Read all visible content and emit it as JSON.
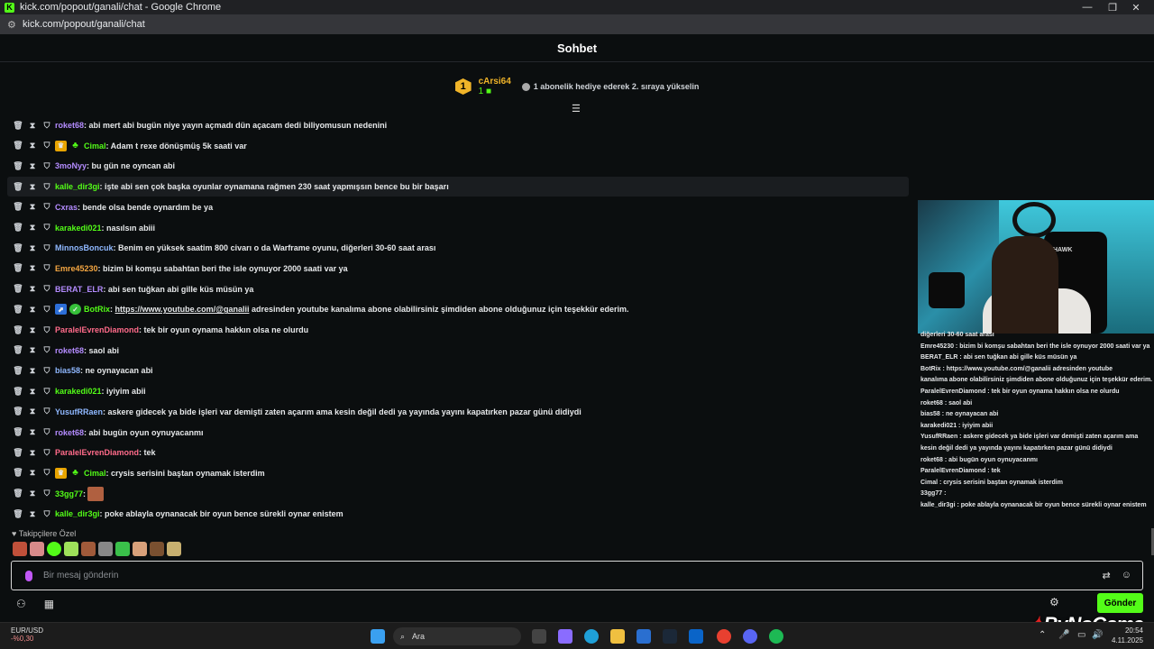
{
  "window": {
    "title": "kick.com/popout/ganali/chat - Google Chrome",
    "url": "kick.com/popout/ganali/chat",
    "favicon": "K"
  },
  "chat": {
    "header": "Sohbet",
    "pinned": {
      "rank": "1",
      "user": "cArsi64",
      "count": "1",
      "message": "1 abonelik hediye ederek 2. sıraya yükselin"
    },
    "messages": [
      {
        "user": "roket68",
        "user_color": "#b48cff",
        "badges": [],
        "text": ": abi mert abi bugün niye yayın açmadı dün açacam dedi biliyomusun nedenini"
      },
      {
        "user": "Cimal",
        "user_color": "#53fc18",
        "badges": [
          "crown",
          "clover"
        ],
        "text": ": Adam t rexe dönüşmüş 5k saati var"
      },
      {
        "user": "3moNyy",
        "user_color": "#b48cff",
        "badges": [],
        "text": ": bu gün ne oyncan abi"
      },
      {
        "user": "kalle_dir3gi",
        "user_color": "#53fc18",
        "badges": [],
        "text": ": işte abi sen çok başka oyunlar oynamana rağmen 230 saat yapmışsın bence bu bir başarı",
        "highlight": true
      },
      {
        "user": "Cxras",
        "user_color": "#b48cff",
        "badges": [],
        "text": ": bende olsa bende oynardım be ya"
      },
      {
        "user": "karakedi021",
        "user_color": "#53fc18",
        "badges": [],
        "text": ": nasılsın abiii"
      },
      {
        "user": "MinnosBoncuk",
        "user_color": "#8fb8ff",
        "badges": [],
        "text": ": Benim en yüksek saatim 800 civarı o da Warframe oyunu, diğerleri 30-60 saat arası"
      },
      {
        "user": "Emre45230",
        "user_color": "#f5a742",
        "badges": [],
        "text": ": bizim bi komşu sabahtan beri the isle oynuyor 2000 saati var ya"
      },
      {
        "user": "BERAT_ELR",
        "user_color": "#b48cff",
        "badges": [],
        "text": ": abi sen tuğkan abi gille küs müsün ya"
      },
      {
        "user": "BotRix",
        "user_color": "#53fc18",
        "badges": [
          "verified",
          "green"
        ],
        "text": ": ",
        "link": "https://www.youtube.com/@ganalii",
        "text2": " adresinden youtube kanalıma abone olabilirsiniz şimdiden abone olduğunuz için teşekkür ederim."
      },
      {
        "user": "ParalelEvrenDiamond",
        "user_color": "#ff6b8a",
        "badges": [],
        "text": ": tek bir oyun oynama hakkın olsa ne olurdu"
      },
      {
        "user": "roket68",
        "user_color": "#b48cff",
        "badges": [],
        "text": ": saol abi"
      },
      {
        "user": "bias58",
        "user_color": "#8fb8ff",
        "badges": [],
        "text": ": ne oynayacan abi"
      },
      {
        "user": "karakedi021",
        "user_color": "#53fc18",
        "badges": [],
        "text": ": iyiyim abii"
      },
      {
        "user": "YusufRRaen",
        "user_color": "#8fb8ff",
        "badges": [],
        "text": ": askere gidecek ya bide işleri var demişti zaten açarım ama kesin değil dedi ya yayında yayını kapatırken pazar günü didiydi"
      },
      {
        "user": "roket68",
        "user_color": "#b48cff",
        "badges": [],
        "text": ": abi bugün oyun oynuyacanmı"
      },
      {
        "user": "ParalelEvrenDiamond",
        "user_color": "#ff6b8a",
        "badges": [],
        "text": ": tek"
      },
      {
        "user": "Cimal",
        "user_color": "#53fc18",
        "badges": [
          "crown",
          "clover"
        ],
        "text": ": crysis serisini baştan oynamak isterdim"
      },
      {
        "user": "33gg77",
        "user_color": "#53fc18",
        "badges": [],
        "text": ":",
        "emote": true
      },
      {
        "user": "kalle_dir3gi",
        "user_color": "#53fc18",
        "badges": [],
        "text": ": poke ablayla oynanacak bir oyun bence sürekli oynar enistem"
      }
    ],
    "followers_label": "Takipçilere Özel",
    "input_placeholder": "Bir mesaj gönderin",
    "send_label": "Gönder"
  },
  "overlay": {
    "brand": "ByNoGame",
    "cam_logo": "HAWK",
    "mini_lines": [
      "diğerleri 30-60 saat arası",
      "Emre45230 : bizim bi komşu sabahtan beri the isle oynuyor 2000 saati var ya",
      "BERAT_ELR : abi sen tuğkan abi gille küs müsün ya",
      "BotRix : https://www.youtube.com/@ganalii adresinden youtube",
      "kanalıma abone olabilirsiniz şimdiden abone olduğunuz için teşekkür ederim.",
      "ParalelEvrenDiamond : tek bir oyun oynama hakkın olsa ne olurdu",
      "roket68 : saol abi",
      "bias58 : ne oynayacan abi",
      "karakedi021 : iyiyim abii",
      "YusufRRaen : askere gidecek ya bide işleri var demişti zaten açarım ama",
      "kesin değil dedi ya yayında yayını kapatırken pazar günü didiydi",
      "roket68 : abi bugün oyun oynuyacanmı",
      "ParalelEvrenDiamond : tek",
      "Cimal : crysis serisini baştan oynamak isterdim",
      "33gg77 :",
      "kalle_dir3gi : poke ablayla oynanacak bir oyun bence sürekli oynar enistem"
    ]
  },
  "taskbar": {
    "ticker": "EUR/USD",
    "ticker_change": "-%0,30",
    "search_label": "Ara",
    "time": "20:54",
    "date": "4.11.2025"
  }
}
